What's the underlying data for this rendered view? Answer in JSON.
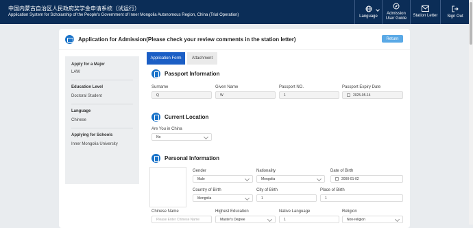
{
  "header": {
    "title_cn": "中国内蒙古自治区人民政府奖学金申请系统（试运行）",
    "title_en": "Application System for Scholarship of the People's Government of Inner Mongolia Autonomous Region, China (Trial Operation)",
    "language_label": "Language",
    "guide_label_1": "Admission",
    "guide_label_2": "User Guide",
    "letter_label": "Station Letter",
    "signout_label": "Sign Out"
  },
  "page": {
    "title": "Application for Admission(Please check your review comments in the station letter)",
    "return_label": "Return"
  },
  "sidebar": {
    "items": [
      {
        "label": "Apply for a Major",
        "value": "LAW"
      },
      {
        "label": "Education Level",
        "value": "Doctoral Student"
      },
      {
        "label": "Language",
        "value": "Chinese"
      },
      {
        "label": "Applying for Schools",
        "value": "Inner Mongolia University"
      }
    ]
  },
  "tabs": [
    {
      "label": "Application Form",
      "active": true
    },
    {
      "label": "Attachment",
      "active": false
    }
  ],
  "passport": {
    "title": "Passport Information",
    "surname_label": "Surname",
    "surname": "Q",
    "given_label": "Given Name",
    "given": "W",
    "no_label": "Passport NO.",
    "no": "1",
    "expiry_label": "Passport Expiry Date",
    "expiry": "2025-05-14"
  },
  "location": {
    "title": "Current Location",
    "in_china_label": "Are You in China",
    "in_china": "No"
  },
  "personal": {
    "title": "Personal Information",
    "gender_label": "Gender",
    "gender": "Male",
    "nationality_label": "Nationality",
    "nationality": "Mongolia",
    "dob_label": "Date of Birth",
    "dob": "2000-01-02",
    "country_birth_label": "Country of Birth",
    "country_birth": "Mongolia",
    "city_birth_label": "City of Birth",
    "city_birth": "1",
    "place_birth_label": "Place of Birth",
    "place_birth": "1",
    "chinese_name_label": "Chinese Name",
    "chinese_name_placeholder": "Please Enter Chinese Name",
    "education_label": "Highest Education",
    "education": "Master's Degree",
    "native_lang_label": "Native Language",
    "native_lang": "1",
    "religion_label": "Religion",
    "religion": "Non-religion"
  },
  "colors": {
    "header_bg": "#0b2d57",
    "accent": "#1b5ec5",
    "return_btn": "#5aa9e6"
  }
}
